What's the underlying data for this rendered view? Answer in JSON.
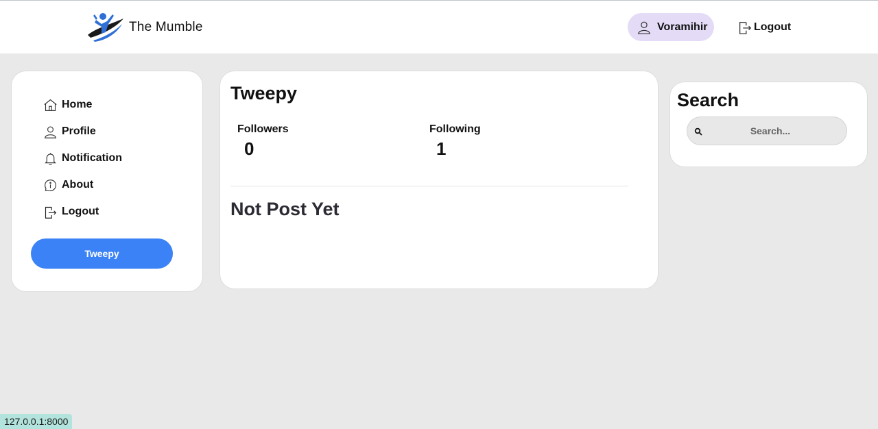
{
  "header": {
    "brand_name": "The Mumble",
    "username": "Voramihir",
    "logout_label": "Logout"
  },
  "sidebar": {
    "items": [
      {
        "label": "Home",
        "icon": "home-icon"
      },
      {
        "label": "Profile",
        "icon": "user-icon"
      },
      {
        "label": "Notification",
        "icon": "bell-icon"
      },
      {
        "label": "About",
        "icon": "info-icon"
      },
      {
        "label": "Logout",
        "icon": "logout-icon"
      }
    ],
    "button_label": "Tweepy"
  },
  "main": {
    "title": "Tweepy",
    "followers_label": "Followers",
    "followers_count": "0",
    "following_label": "Following",
    "following_count": "1",
    "empty_message": "Not Post Yet"
  },
  "search": {
    "title": "Search",
    "placeholder": "Search..."
  },
  "status_bar": {
    "url": "127.0.0.1:8000"
  },
  "colors": {
    "accent": "#3b82f6",
    "user_pill": "#e4dcf7",
    "background": "#e9e9e9"
  }
}
